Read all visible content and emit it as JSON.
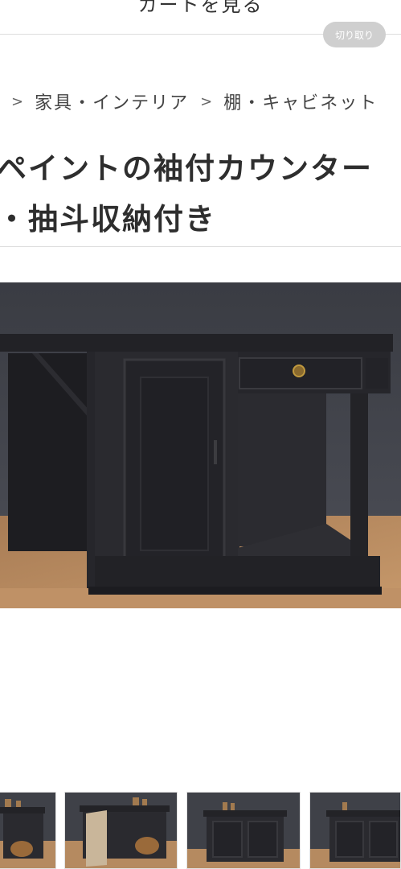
{
  "header": {
    "link_text": "カートを見る"
  },
  "clip_button": {
    "label": "切り取り"
  },
  "breadcrumb": {
    "separator": ">",
    "items": [
      "家具・インテリア",
      "棚・キャビネット"
    ]
  },
  "product": {
    "title_line1": "ペイントの袖付カウンター",
    "title_line2": "・抽斗収納付き"
  },
  "colors": {
    "cabinet": "#25252a",
    "wall": "#3b3d44",
    "floor": "#b5875c",
    "clip_button_bg": "#cfcfcf"
  },
  "gallery": {
    "thumbnail_count": 4,
    "selected_index": 0
  }
}
